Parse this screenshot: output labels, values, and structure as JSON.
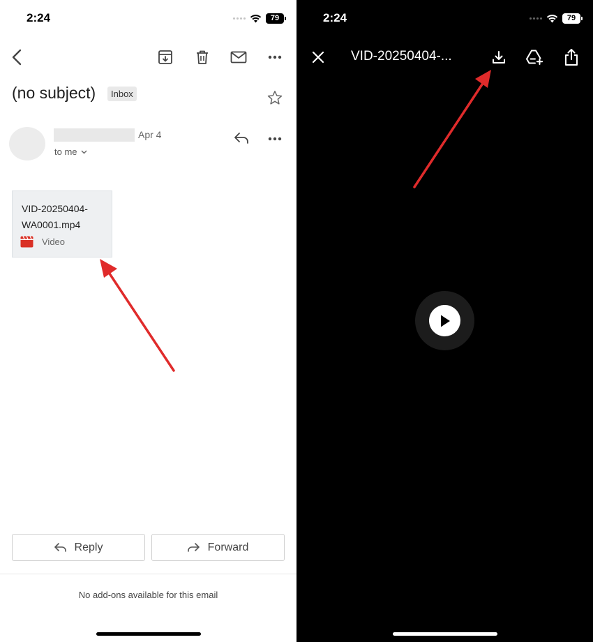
{
  "email_view": {
    "status_time": "2:24",
    "battery": "79",
    "subject": "(no subject)",
    "label": "Inbox",
    "date": "Apr 4",
    "recipient": "to me",
    "attachment": {
      "name": "VID-20250404-WA0001.mp4",
      "type": "Video"
    },
    "reply_label": "Reply",
    "forward_label": "Forward",
    "addons_note": "No add-ons available for this email"
  },
  "video_view": {
    "status_time": "2:24",
    "battery": "79",
    "title": "VID-20250404-..."
  },
  "colors": {
    "annotation_arrow": "#e02b2b",
    "video_icon": "#d93025"
  },
  "icons": [
    "back-icon",
    "archive-icon",
    "trash-icon",
    "mail-icon",
    "more-icon",
    "star-icon",
    "reply-icon",
    "chevron-down-icon",
    "video-file-icon",
    "forward-icon",
    "close-icon",
    "download-icon",
    "add-to-drive-icon",
    "share-icon",
    "play-icon"
  ]
}
